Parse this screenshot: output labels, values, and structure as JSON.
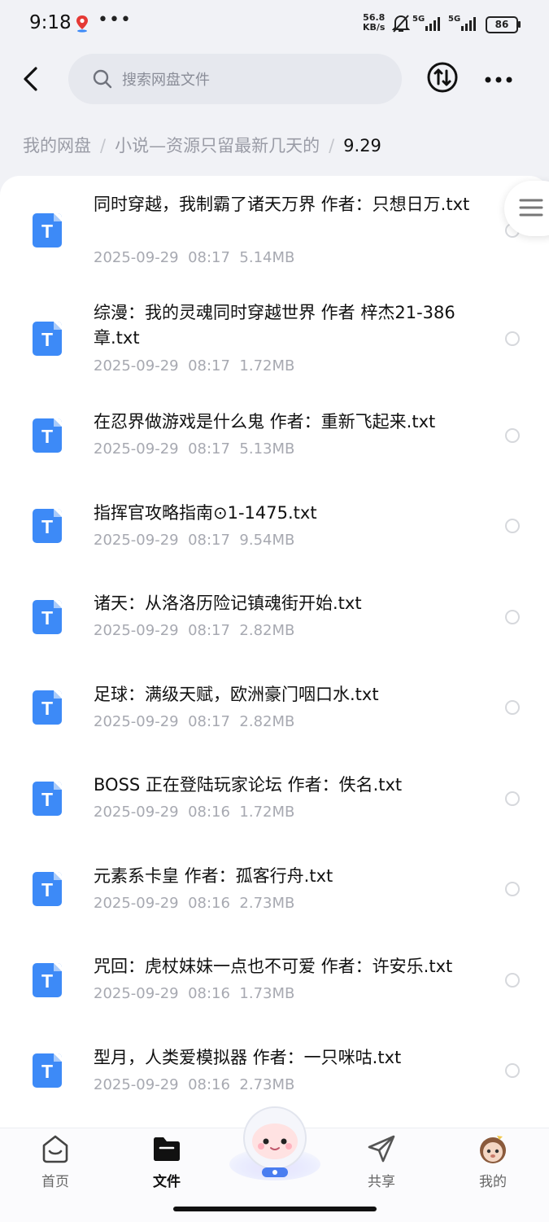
{
  "status_bar": {
    "time": "9:18",
    "net_speed_value": "56.8",
    "net_speed_unit": "KB/s",
    "signal_1": "5G",
    "signal_2": "5G",
    "battery": "86"
  },
  "header": {
    "search_placeholder": "搜索网盘文件"
  },
  "breadcrumb": {
    "items": [
      "我的网盘",
      "小说—资源只留最新几天的"
    ],
    "separator": "/",
    "current": "9.29"
  },
  "files": [
    {
      "icon": "T",
      "name": "同时穿越，我制霸了诸天万界 作者：只想日万.txt",
      "date": "2025-09-29",
      "time": "08:17",
      "size": "5.14MB"
    },
    {
      "icon": "T",
      "name": "综漫：我的灵魂同时穿越世界 作者 梓杰21-386章.txt",
      "date": "2025-09-29",
      "time": "08:17",
      "size": "1.72MB"
    },
    {
      "icon": "T",
      "name": "在忍界做游戏是什么鬼 作者：重新飞起来.txt",
      "date": "2025-09-29",
      "time": "08:17",
      "size": "5.13MB"
    },
    {
      "icon": "T",
      "name": "指挥官攻略指南⊙1-1475.txt",
      "date": "2025-09-29",
      "time": "08:17",
      "size": "9.54MB"
    },
    {
      "icon": "T",
      "name": "诸天：从洛洛历险记镇魂街开始.txt",
      "date": "2025-09-29",
      "time": "08:17",
      "size": "2.82MB"
    },
    {
      "icon": "T",
      "name": "足球：满级天赋，欧洲豪门咽口水.txt",
      "date": "2025-09-29",
      "time": "08:17",
      "size": "2.82MB"
    },
    {
      "icon": "T",
      "name": "BOSS 正在登陆玩家论坛 作者：佚名.txt",
      "date": "2025-09-29",
      "time": "08:16",
      "size": "1.72MB"
    },
    {
      "icon": "T",
      "name": "元素系卡皇 作者：孤客行舟.txt",
      "date": "2025-09-29",
      "time": "08:16",
      "size": "2.73MB"
    },
    {
      "icon": "T",
      "name": "咒回：虎杖妹妹一点也不可爱 作者：许安乐.txt",
      "date": "2025-09-29",
      "time": "08:16",
      "size": "1.73MB"
    },
    {
      "icon": "T",
      "name": "型月，人类爱模拟器 作者：一只咪咕.txt",
      "date": "2025-09-29",
      "time": "08:16",
      "size": "2.73MB"
    }
  ],
  "bottom_nav": {
    "items": [
      {
        "label": "首页",
        "icon": "home-icon"
      },
      {
        "label": "文件",
        "icon": "folder-icon",
        "active": true
      },
      {
        "label": "共享",
        "icon": "share-icon"
      },
      {
        "label": "我的",
        "icon": "avatar-icon"
      }
    ]
  },
  "colors": {
    "accent": "#3d8af7",
    "background": "#f1f2f6",
    "meta_text": "#a7a9b1"
  }
}
